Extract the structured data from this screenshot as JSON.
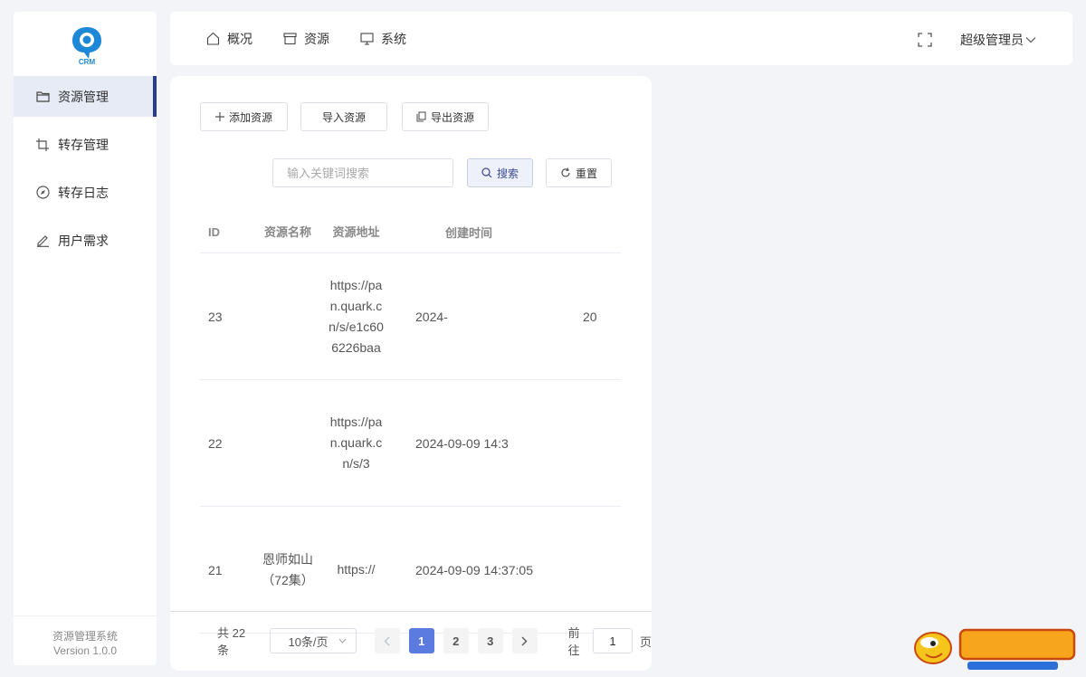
{
  "sidebar": {
    "logo_text": "CRM",
    "items": [
      {
        "label": "资源管理",
        "icon": "folder-icon",
        "active": true
      },
      {
        "label": "转存管理",
        "icon": "crop-icon",
        "active": false
      },
      {
        "label": "转存日志",
        "icon": "compass-icon",
        "active": false
      },
      {
        "label": "用户需求",
        "icon": "edit-icon",
        "active": false
      }
    ],
    "footer_name": "资源管理系统",
    "footer_version": "Version 1.0.0"
  },
  "topbar": {
    "nav": [
      {
        "label": "概况",
        "icon": "home-icon"
      },
      {
        "label": "资源",
        "icon": "box-icon"
      },
      {
        "label": "系统",
        "icon": "monitor-icon"
      }
    ],
    "user": "超级管理员"
  },
  "toolbar": {
    "add_label": "添加资源",
    "import_label": "导入资源",
    "export_label": "导出资源"
  },
  "search": {
    "placeholder": "输入关键词搜索",
    "search_label": "搜索",
    "reset_label": "重置"
  },
  "table": {
    "headers": {
      "id": "ID",
      "name": "资源名称",
      "url": "资源地址",
      "time": "创建时间"
    },
    "rows": [
      {
        "id": "23",
        "name": "",
        "url": "https://pan.quark.cn/s/e1c606226baa",
        "time": "2024-",
        "more": "20"
      },
      {
        "id": "22",
        "name": "",
        "url": "https://pan.quark.cn/s/3",
        "time": "2024-09-09 14:3",
        "more": ""
      },
      {
        "id": "21",
        "name": "恩师如山（72集）",
        "url": "https://",
        "time": "2024-09-09 14:37:05",
        "more": ""
      }
    ]
  },
  "pagination": {
    "total": "共 22 条",
    "page_size": "10条/页",
    "pages": [
      "1",
      "2",
      "3"
    ],
    "current": "1",
    "goto_label": "前往",
    "goto_value": "1",
    "page_unit": "页"
  },
  "colors": {
    "accent": "#2b3d8f",
    "active_page": "#5b7be0",
    "active_menu_bg": "#e6ebf5"
  }
}
